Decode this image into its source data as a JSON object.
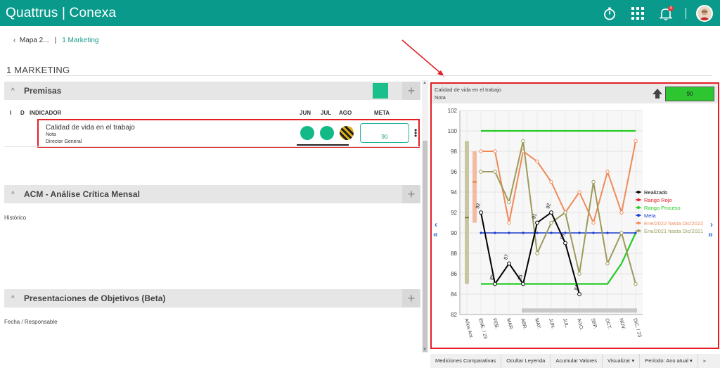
{
  "app": {
    "brand": "Quattrus | Conexa",
    "notification_count": "4",
    "icons": [
      "stopwatch-icon",
      "apps-grid-icon",
      "bell-icon",
      "user-avatar"
    ]
  },
  "breadcrumb": {
    "back_label": "Mapa 2...",
    "current": "1 Marketing"
  },
  "page": {
    "title": "1 MARKETING"
  },
  "sections": {
    "premisas": {
      "title": "Premisas",
      "plus": "+"
    },
    "acm": {
      "title": "ACM - Análise Crítica Mensal",
      "plus": "+",
      "body": "Histórico"
    },
    "presentaciones": {
      "title": "Presentaciones de Objetivos (Beta)",
      "plus": "+",
      "body": "Fecha / Responsable"
    }
  },
  "table": {
    "headers": {
      "i": "I",
      "d": "D",
      "indicador": "INDICADOR",
      "jun": "JUN",
      "jul": "JUL",
      "ago": "AGO",
      "meta": "META"
    },
    "row": {
      "name": "Calidad de vida en el trabajo",
      "type": "Nota",
      "owner": "Director General",
      "meta": "90",
      "status_jun": "green",
      "status_jul": "green",
      "status_ago": "striped-warning"
    }
  },
  "chart_panel": {
    "title": "Calidad de vida en el trabajo",
    "subtitle": "Nota",
    "value": "90",
    "trend_icon": "up-arrow-icon",
    "colors": {
      "header_value_bg": "#2dc631",
      "panel_border": "#e31e24"
    }
  },
  "chart_data": {
    "type": "line",
    "categories": [
      "Años Ant.",
      "ENE. / 23",
      "FEB.",
      "MAR.",
      "ABR.",
      "MAY.",
      "JUN.",
      "JUL.",
      "AGO.",
      "SEP.",
      "OCT.",
      "NOV.",
      "DIC. / 23"
    ],
    "ylim": [
      82,
      102
    ],
    "yticks": [
      82,
      84,
      86,
      88,
      90,
      92,
      94,
      96,
      98,
      100,
      102
    ],
    "series": [
      {
        "name": "Realizado",
        "color": "#000000",
        "x": [
          1,
          2,
          3,
          4,
          5,
          6,
          7,
          8
        ],
        "values": [
          92,
          85,
          87,
          85,
          91,
          92,
          89,
          84
        ],
        "labels": [
          "92",
          "85",
          "87",
          "85",
          "91",
          "92",
          "89",
          "84"
        ]
      },
      {
        "name": "Rango Rojo",
        "color": "#e31e24",
        "x": [],
        "values": []
      },
      {
        "name": "Rango Proceso",
        "color": "#22cc22",
        "x": [
          1,
          2,
          3,
          4,
          5,
          6,
          7,
          8,
          9,
          10,
          11,
          12
        ],
        "values": [
          100,
          100,
          100,
          100,
          100,
          100,
          100,
          100,
          100,
          100,
          100,
          100
        ],
        "lower": [
          85,
          85,
          85,
          85,
          85,
          85,
          85,
          85,
          85,
          85,
          87,
          90
        ]
      },
      {
        "name": "Meta",
        "color": "#1a3ccf",
        "x": [
          1,
          2,
          3,
          4,
          5,
          6,
          7,
          8,
          9,
          10,
          11,
          12
        ],
        "values": [
          90,
          90,
          90,
          90,
          90,
          90,
          90,
          90,
          90,
          90,
          90,
          90
        ]
      },
      {
        "name": "Ene/2022 hasta Dic/2022",
        "color": "#ef8a5a",
        "x": [
          1,
          2,
          3,
          4,
          5,
          6,
          7,
          8,
          9,
          10,
          11,
          12
        ],
        "values": [
          98,
          98,
          91,
          98,
          97,
          95,
          92,
          94,
          91,
          96,
          92,
          99
        ]
      },
      {
        "name": "Ene/2021 hasta Dic/2021",
        "color": "#9c9a5a",
        "x": [
          1,
          2,
          3,
          4,
          5,
          6,
          7,
          8,
          9,
          10,
          11,
          12
        ],
        "values": [
          96,
          96,
          93,
          99,
          88,
          91,
          92,
          86,
          95,
          87,
          90,
          85
        ]
      }
    ],
    "previous_years_bar": {
      "low": 85,
      "high": 99,
      "mark": 91.5
    },
    "previous_years_bar_2022": {
      "low": 91,
      "high": 98,
      "mark": 95
    },
    "legend_position": "right",
    "grid": true
  },
  "bottom_toolbar": {
    "items": [
      "Mediciones Comparativas",
      "Ocultar Leyenda",
      "Acumular Valores",
      "Visualizar ▾",
      "Período: Ano atual ▾",
      "»"
    ]
  }
}
